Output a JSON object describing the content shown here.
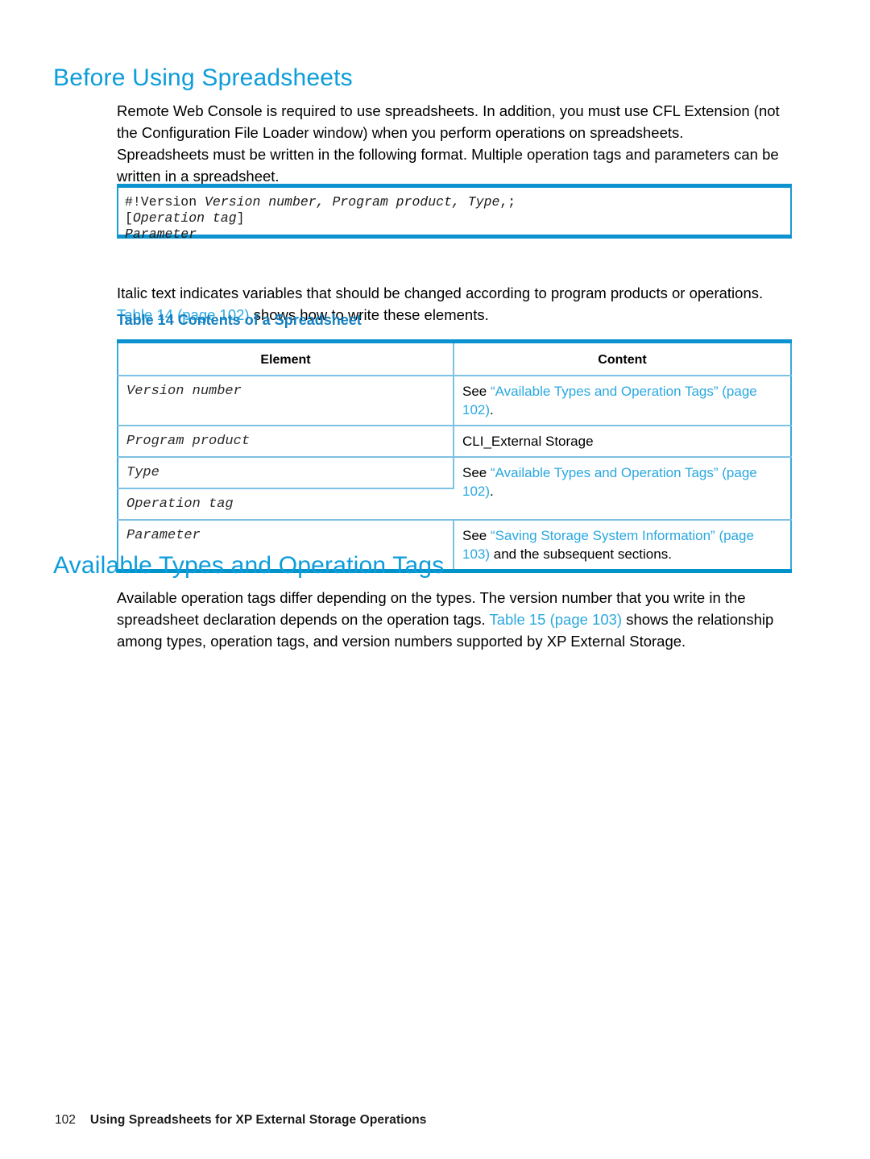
{
  "document": {
    "sections": [
      {
        "id": "before-using",
        "heading": "Before Using Spreadsheets"
      },
      {
        "id": "available-types",
        "heading": "Available Types and Operation Tags"
      }
    ]
  },
  "paragraphs": {
    "remote_console": "Remote Web Console is required to use spreadsheets. In addition, you must use CFL Extension (not the Configuration File Loader window) when you perform operations on spreadsheets.",
    "format": "Spreadsheets must be written in the following format. Multiple operation tags and parameters can be written in a spreadsheet.",
    "italic_note_part1": "Italic text indicates variables that should be changed according to program products or operations. ",
    "italic_note_link": "Table 14 (page 102)",
    "italic_note_part2": " shows how to write these elements.",
    "available_part1": "Available operation tags differ depending on the types. The version number that you write in the spreadsheet declaration depends on the operation tags. ",
    "available_link": "Table 15 (page 103)",
    "available_part2": " shows the relationship among types, operation tags, and version numbers supported by XP External Storage."
  },
  "code_block": {
    "line1_prefix": "#!Version ",
    "line1_italic": "Version number, Program product, Type",
    "line1_suffix": ",;",
    "line2_prefix": "[",
    "line2_italic": "Operation tag",
    "line2_suffix": "]",
    "line3_italic": "Parameter"
  },
  "table": {
    "caption": "Table 14 Contents of a Spreadsheet",
    "headers": [
      "Element",
      "Content"
    ],
    "rows": [
      {
        "element": "Version number",
        "content_prefix": "See ",
        "content_link": "“Available Types and Operation Tags” (page 102)",
        "content_suffix": "."
      },
      {
        "element": "Program product",
        "content_plain": "CLI_External Storage"
      },
      {
        "element": "Type",
        "content_prefix": "See ",
        "content_link": "“Available Types and Operation Tags” (page 102)",
        "content_suffix": "."
      },
      {
        "element": "Operation tag",
        "content_merged_above": true
      },
      {
        "element": "Parameter",
        "content_prefix": "See ",
        "content_link": "“Saving Storage System Information” (page 103)",
        "content_suffix": " and the subsequent sections."
      }
    ]
  },
  "footer": {
    "page_number": "102",
    "title": "Using Spreadsheets for XP External Storage Operations"
  },
  "colors": {
    "heading_blue": "#0d9ddb",
    "link_blue": "#2aa8e0",
    "caption_blue": "#1580c0",
    "table_border_heavy": "#0c93cf",
    "table_border_light": "#7dc1e5",
    "table_border_bottom": "#0093c9"
  }
}
